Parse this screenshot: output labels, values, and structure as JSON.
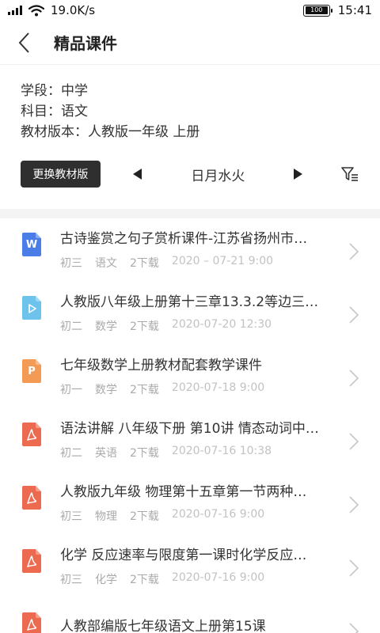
{
  "status": {
    "speed": "19.0K/s",
    "battery": "100",
    "time": "15:41"
  },
  "nav": {
    "title": "精品课件"
  },
  "info": {
    "stage": "学段：中学",
    "subject": "科目：语文",
    "edition": "教材版本：人教版一年级 上册"
  },
  "controls": {
    "change_button": "更换教材版本",
    "week_label": "日月水火"
  },
  "icons": {
    "word": "#4a7ee6",
    "video": "#6ec3ec",
    "ppt": "#f39a55",
    "pdf": "#ec6a4f"
  },
  "items": [
    {
      "type": "word",
      "letter": "W",
      "title": "古诗鉴赏之句子赏析课件-江苏省扬州市…",
      "grade": "初三",
      "subject": "语文",
      "downloads": "2下载",
      "date": "2020 – 07-21 9:00"
    },
    {
      "type": "video",
      "letter": "",
      "title": "人教版八年级上册第十三章13.3.2等边三…",
      "grade": "初二",
      "subject": "数学",
      "downloads": "2下载",
      "date": "2020-07-20 12:30"
    },
    {
      "type": "ppt",
      "letter": "P",
      "title": "七年级数学上册教材配套教学课件",
      "grade": "初一",
      "subject": "数学",
      "downloads": "2下载",
      "date": "2020-07-18 9:00"
    },
    {
      "type": "pdf",
      "letter": "",
      "title": "语法讲解 八年级下册 第10讲 情态动词中…",
      "grade": "初二",
      "subject": "英语",
      "downloads": "2下载",
      "date": "2020-07-16 10:38"
    },
    {
      "type": "pdf",
      "letter": "",
      "title": "人教版九年级 物理第十五章第一节两种…",
      "grade": "初三",
      "subject": "物理",
      "downloads": "2下载",
      "date": "2020-07-16  9:00"
    },
    {
      "type": "pdf",
      "letter": "",
      "title": "化学 反应速率与限度第一课时化学反应…",
      "grade": "初三",
      "subject": "化学",
      "downloads": "2下载",
      "date": "2020-07-16  9:00"
    },
    {
      "type": "pdf",
      "letter": "",
      "title": "人教部编版七年级语文上册第15课",
      "grade": "",
      "subject": "",
      "downloads": "",
      "date": ""
    }
  ]
}
